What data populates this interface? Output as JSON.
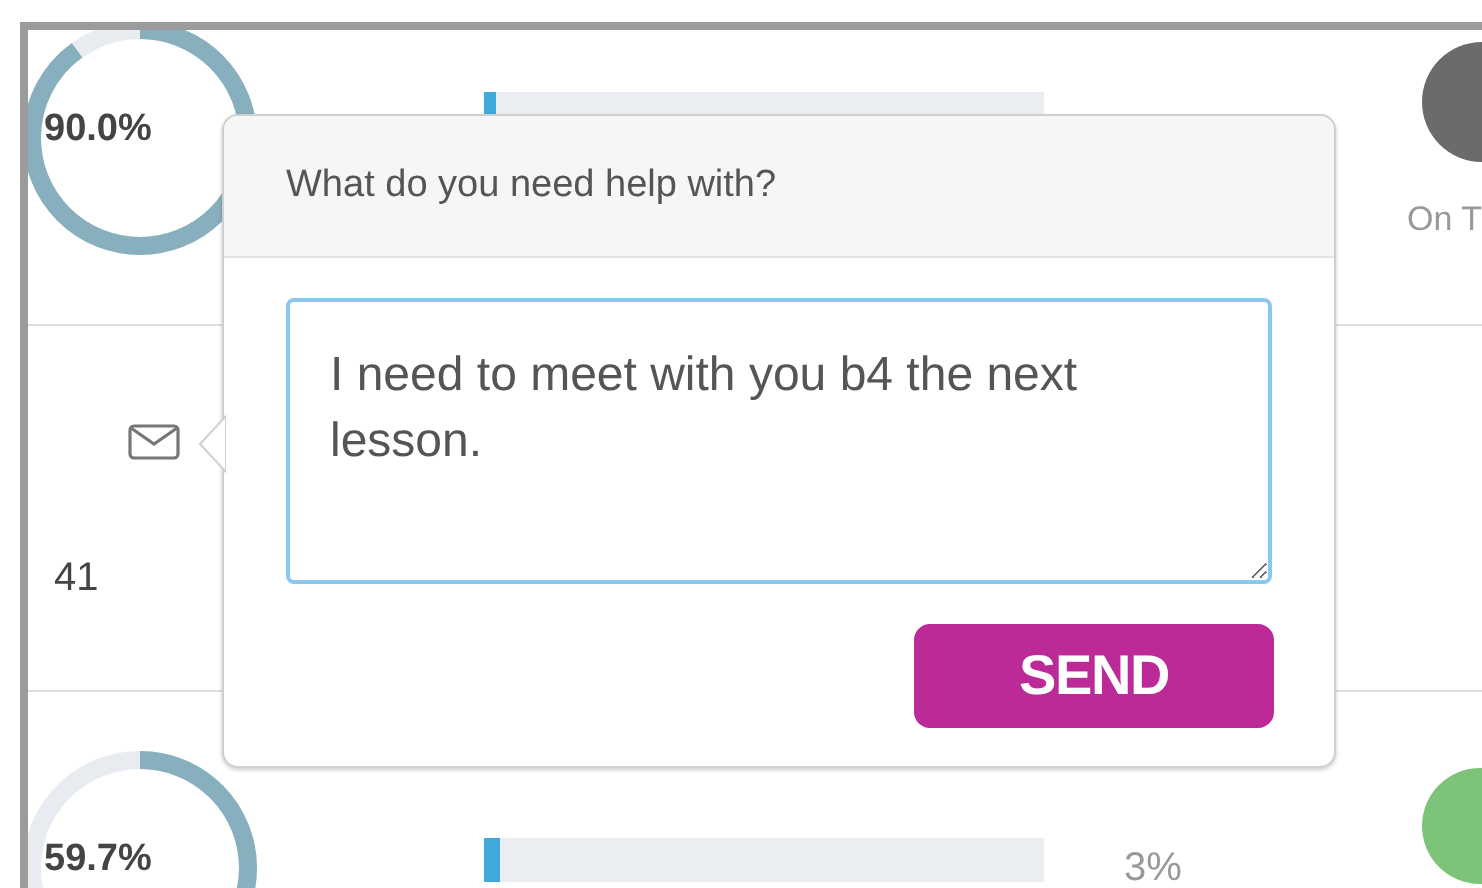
{
  "rows": [
    {
      "score": "90.0%",
      "bar": {
        "level": 0.02
      },
      "status": "On T",
      "status_icon": {
        "color": "#6b6b6b"
      }
    },
    {
      "count": "41"
    },
    {
      "score": "59.7%",
      "bar": {
        "level": 0.03
      },
      "bar_reading": "3%",
      "status_icon": {
        "color": "#7dc47a"
      }
    }
  ],
  "popover": {
    "title": "What do you need help with?",
    "message": "I need to meet with you b4 the next lesson.",
    "button": "SEND"
  }
}
